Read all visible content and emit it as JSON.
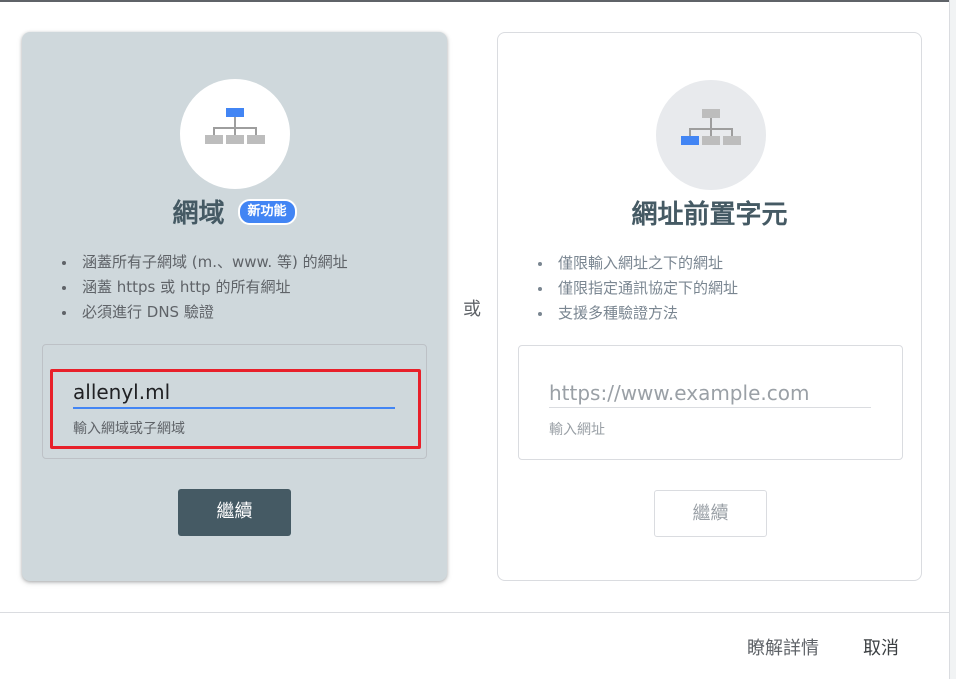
{
  "domain_card": {
    "icon": "sitemap-icon",
    "title": "網域",
    "badge": "新功能",
    "features": [
      "涵蓋所有子網域 (m.、www. 等) 的網址",
      "涵蓋 https 或 http 的所有網址",
      "必須進行 DNS 驗證"
    ],
    "input_value": "allenyl.ml",
    "input_hint": "輸入網域或子網域",
    "button_label": "繼續",
    "colors": {
      "card_bg": "#cfd8dc",
      "button_bg": "#455a64",
      "accent": "#4285f4",
      "highlight_box": "#e8202a"
    }
  },
  "separator_text": "或",
  "prefix_card": {
    "icon": "sitemap-icon",
    "title": "網址前置字元",
    "features": [
      "僅限輸入網址之下的網址",
      "僅限指定通訊協定下的網址",
      "支援多種驗證方法"
    ],
    "input_placeholder": "https://www.example.com",
    "input_hint": "輸入網址",
    "button_label": "繼續"
  },
  "footer": {
    "learn_more": "瞭解詳情",
    "cancel": "取消"
  }
}
